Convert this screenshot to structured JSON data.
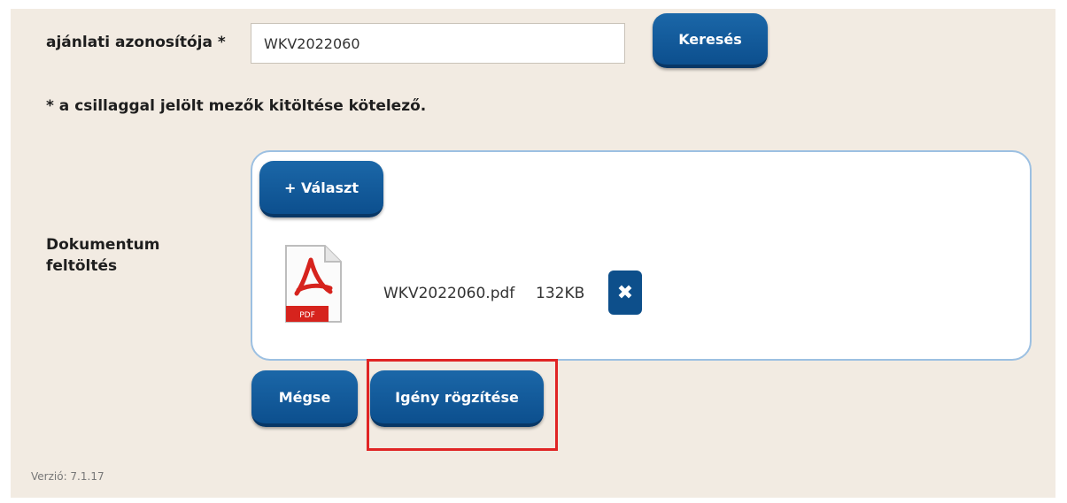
{
  "form": {
    "id_label": "ajánlati azonosítója *",
    "id_value": "WKV2022060",
    "search_button": "Keresés",
    "required_note": "* a csillaggal jelölt mezők kitöltése kötelező.",
    "doc_label_line1": "Dokumentum",
    "doc_label_line2": "feltöltés"
  },
  "upload": {
    "choose_button": "+ Választ",
    "file": {
      "name": "WKV2022060.pdf",
      "size": "132KB",
      "icon": "pdf-file-icon",
      "remove_icon": "✖"
    }
  },
  "actions": {
    "cancel": "Mégse",
    "submit": "Igény rögzítése"
  },
  "footer": {
    "version": "Verzió: 7.1.17"
  },
  "colors": {
    "button": "#0c4f8e",
    "highlight": "#e02424",
    "pdf_red": "#d6231d"
  }
}
